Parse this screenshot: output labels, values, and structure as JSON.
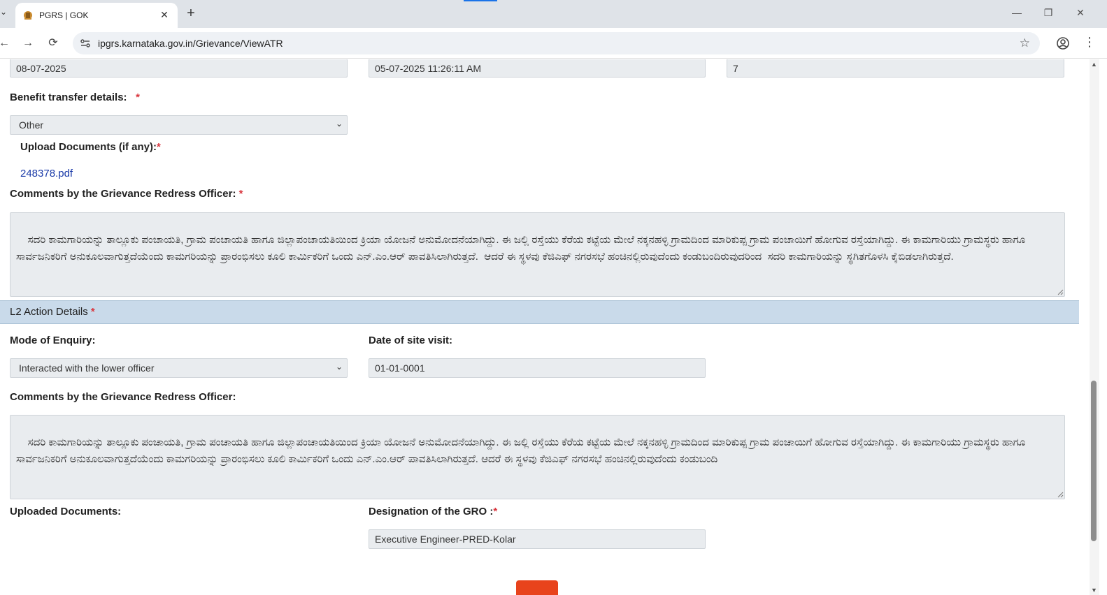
{
  "browser": {
    "tab_title": "PGRS | GOK",
    "tab_close": "✕",
    "new_tab": "+",
    "url": "ipgrs.karnataka.gov.in/Grievance/ViewATR",
    "window_minimize": "—",
    "window_restore": "❐",
    "window_close": "✕",
    "back": "←",
    "forward": "→",
    "reload": "⟳",
    "star": "☆",
    "menu": "⋮"
  },
  "top_row": {
    "field1": "08-07-2025",
    "field2": "05-07-2025 11:26:11 AM",
    "field3": "7"
  },
  "benefit_transfer": {
    "label": "Benefit transfer details:",
    "required": "*",
    "value": "Other"
  },
  "upload": {
    "label": "Upload Documents (if any):",
    "required": "*",
    "file": "248378.pdf"
  },
  "l1_comments": {
    "label": "Comments by the Grievance Redress Officer:",
    "required": "*",
    "text": "ಸದರಿ ಕಾಮಗಾರಿಯನ್ನು ತಾಲ್ಲೂಕು ಪಂಚಾಯತಿ, ಗ್ರಾಮ ಪಂಚಾಯತಿ ಹಾಗೂ ಜಿಲ್ಲಾಪಂಚಾಯತಿಯಿಂದ ಕ್ರಿಯಾ ಯೋಜನೆ ಅನುಮೋದನೆಯಾಗಿದ್ದು. ಈ ಜಲ್ಲಿ ರಸ್ತೆಯು ಕೆರೆಯ ಕಟ್ಟೆಯ ಮೇಲೆ ನಕ್ಕನಹಳ್ಳಿ ಗ್ರಾಮದಿಂದ ಮಾರಿಕುಪ್ಪ ಗ್ರಾಮ ಪಂಚಾಯಿಗೆ ಹೋಗುವ ರಸ್ತೆಯಾಗಿದ್ದು. ಈ ಕಾಮಗಾರಿಯು ಗ್ರಾಮಸ್ಥರು ಹಾಗೂ ಸಾರ್ವಜನಿಕರಿಗೆ ಅನುಕೂಲವಾಗುತ್ತದೆಯೆಂದು ಕಾಮಗರಿಯನ್ನು ಪ್ರಾರಂಭಿಸಲು ಕೂಲಿ ಕಾರ್ಮಿಕರಿಗೆ ಒಂದು ಎನ್.ಎಂ.ಆರ್ ಪಾವತಿಸಿಲಾಗಿರುತ್ತದೆ.  ಆದರೆ ಈ ಸ್ಥಳವು ಕೆಜಿಎಫ್ ನಗರಸಭೆ ಹಂಚಿನಲ್ಲಿರುವುದೆಂದು ಕಂಡುಬಂದಿರುವುದರಿಂದ  ಸದರಿ ಕಾಮಗಾರಿಯನ್ನು ಸ್ಥಗಿತಗೊಳಸಿ ಕೈಬಿಡಲಾಗಿರುತ್ತದೆ."
  },
  "l2": {
    "section_title": "L2 Action Details",
    "required": "*",
    "mode_label": "Mode of Enquiry:",
    "mode_value": "Interacted with the lower officer",
    "visit_label": "Date of site visit:",
    "visit_value": "01-01-0001",
    "comments_label": "Comments by the Grievance Redress Officer:",
    "comments_text": "ಸದರಿ ಕಾಮಗಾರಿಯನ್ನು ತಾಲ್ಲೂಕು ಪಂಚಾಯತಿ, ಗ್ರಾಮ ಪಂಚಾಯತಿ ಹಾಗೂ ಜಿಲ್ಲಾಪಂಚಾಯತಿಯಿಂದ ಕ್ರಿಯಾ ಯೋಜನೆ ಅನುಮೋದನೆಯಾಗಿದ್ದು. ಈ ಜಲ್ಲಿ ರಸ್ತೆಯು ಕೆರೆಯ ಕಟ್ಟೆಯ ಮೇಲೆ ನಕ್ಕನಹಳ್ಳಿ ಗ್ರಾಮದಿಂದ ಮಾರಿಕುಪ್ಪ ಗ್ರಾಮ ಪಂಚಾಯಿಗೆ ಹೋಗುವ ರಸ್ತೆಯಾಗಿದ್ದು. ಈ ಕಾಮಗಾರಿಯು ಗ್ರಾಮಸ್ಥರು ಹಾಗೂ ಸಾರ್ವಜನಿಕರಿಗೆ ಅನುಕೂಲವಾಗುತ್ತದೆಯೆಂದು ಕಾಮಗರಿಯನ್ನು ಪ್ರಾರಂಭಿಸಲು ಕೂಲಿ ಕಾರ್ಮಿಕರಿಗೆ ಒಂದು ಎನ್.ಎಂ.ಆರ್ ಪಾವತಿಸಿಲಾಗಿರುತ್ತದೆ. ಆದರೆ ಈ ಸ್ಥಳವು ಕೆಜಿಎಫ್ ನಗರಸಭೆ ಹಂಚಿನಲ್ಲಿರುವುದೆಂದು ಕಂಡುಬಂದಿ",
    "uploaded_label": "Uploaded Documents:",
    "designation_label": "Designation of the GRO :",
    "designation_required": "*",
    "designation_value": "Executive Engineer-PRED-Kolar"
  },
  "colors": {
    "section_bar": "#c9daea",
    "required": "#d9363e",
    "link": "#1a3aa8",
    "submit": "#e8431c"
  }
}
